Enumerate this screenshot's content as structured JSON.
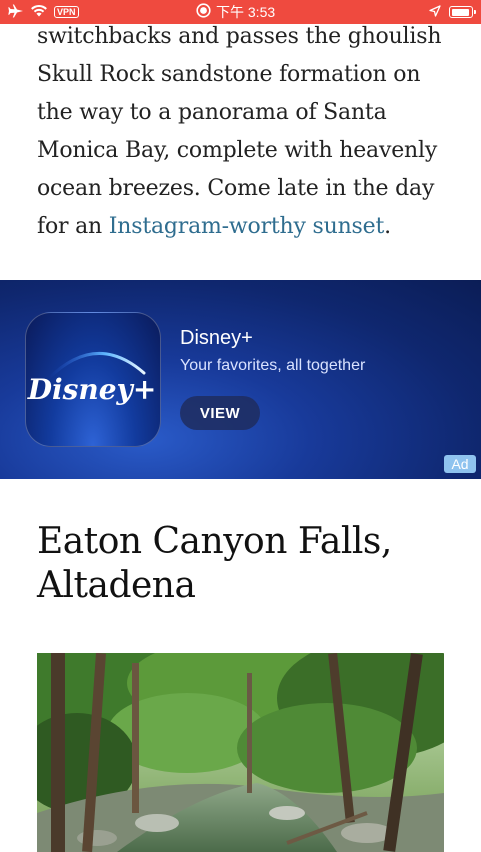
{
  "status_bar": {
    "vpn": "VPN",
    "time": "下午 3:53"
  },
  "article": {
    "paragraph_text": "switchbacks and passes the ghoulish Skull Rock sandstone formation on the way to a panorama of Santa Monica Bay, complete with heavenly ocean breezes. Come late in the day for an ",
    "link_text": "Instagram-worthy sunset",
    "paragraph_end": "."
  },
  "ad": {
    "title": "Disney+",
    "subtitle": "Your favorites, all together",
    "button_label": "VIEW",
    "badge": "Ad",
    "logo_text": "Disney+"
  },
  "section": {
    "heading": "Eaton Canyon Falls, Altadena"
  },
  "colors": {
    "status_bar": "#ef4a3f",
    "link": "#2f6d8f",
    "ad_background": "#0f276f"
  }
}
